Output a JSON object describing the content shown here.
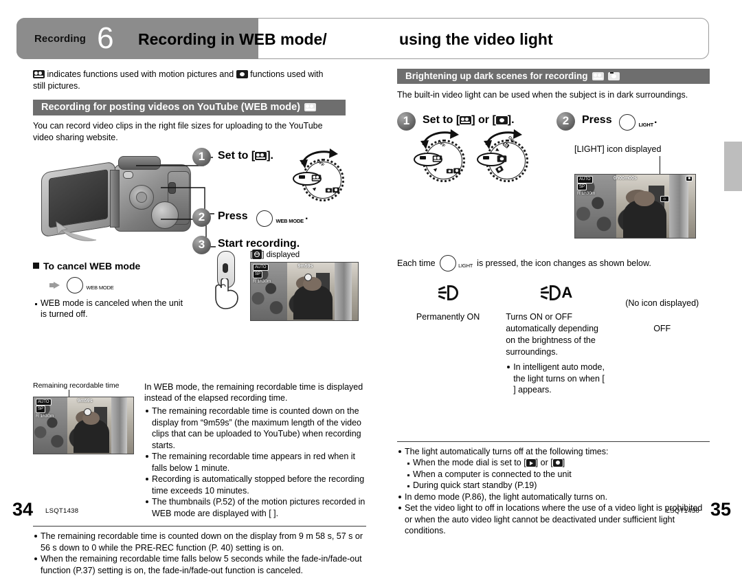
{
  "header": {
    "chapter_label": "Recording",
    "chapter_number": "6",
    "title_left": "Recording in WEB mode/",
    "title_right": "using the video light"
  },
  "left_page": {
    "intro": {
      "text_before": "indicates functions used with motion pictures and",
      "text_middle": "functions used with",
      "text_after": "still pictures.",
      "icon_motion": "motion-picture-icon",
      "icon_still": "still-picture-icon"
    },
    "section_band": {
      "label": "Recording for posting videos on YouTube (WEB mode)",
      "icon": "motion-picture-icon"
    },
    "section_desc": "You can record video clips in the right file sizes for uploading to the YouTube video sharing website.",
    "steps": [
      {
        "number": "1",
        "label": "Set to [",
        "label_end": "]."
      },
      {
        "number": "2",
        "label": "Press",
        "button_caption": "WEB MODE"
      },
      {
        "number": "3",
        "label": "Start recording."
      }
    ],
    "step3_caption": "] displayed",
    "cancel_heading": "To cancel WEB mode",
    "cancel_button_caption": "WEB MODE",
    "cancel_note": "WEB mode is canceled when the unit is turned off.",
    "thumb_caption": "Remaining recordable time",
    "thumb_osd": {
      "auto_chip": "AUTO",
      "timer": "9m59s",
      "card_chip": "SP",
      "remain": "R 1h30m"
    },
    "explain_intro": "In WEB mode, the remaining recordable time is displayed instead of the elapsed recording time.",
    "bullets": [
      "The remaining recordable time is counted down on the display from “9m59s” (the maximum length of the video clips that can be uploaded to YouTube) when recording starts.",
      "The remaining recordable time appears in red when it falls below 1 minute.",
      "Recording is automatically stopped before the recording time exceeds 10 minutes.",
      "The thumbnails (P.52) of the motion pictures recorded in WEB mode are displayed with [      ]."
    ],
    "footer_bullets": [
      "The remaining recordable time is counted down on the display from 9 m 58 s, 57 s or 56 s down to 0 while the PRE-REC function (P. 40) setting is on.",
      "When the remaining recordable time falls below 5 seconds while the fade-in/fade-out function (P.37) setting is on, the fade-in/fade-out function is canceled."
    ],
    "page_number": "34",
    "doc_code": "LSQT1438"
  },
  "right_page": {
    "section_band": {
      "label": "Brightening up dark scenes for recording",
      "icon_motion": "motion-picture-icon",
      "icon_still": "still-picture-icon"
    },
    "section_desc": "The built-in video light can be used when the subject is in dark surroundings.",
    "step1": {
      "number": "1",
      "label_start": "Set to [",
      "label_mid": "] or [",
      "label_end": "]."
    },
    "step2": {
      "number": "2",
      "label": "Press",
      "button_caption": "LIGHT"
    },
    "lcd_caption": "[LIGHT] icon displayed",
    "lcd_osd": {
      "auto_chip": "AUTO",
      "timer": "0h00m00s",
      "card_chip": "SP",
      "remain": "R 1h30m",
      "light_badge": "LIGHT"
    },
    "each_time": {
      "before": "Each time",
      "after": "is pressed, the icon changes as shown below.",
      "button_caption": "LIGHT"
    },
    "modes": [
      {
        "icon": "video-light-on-icon",
        "title": "Permanently ON",
        "body": "",
        "note": ""
      },
      {
        "icon": "video-light-auto-icon",
        "title": "Turns ON or OFF automatically depending on the brightness of the surroundings.",
        "note": "In intelligent auto mode, the light turns on when [      ] appears."
      },
      {
        "icon": "no-icon",
        "icon_text": "(No icon displayed)",
        "title": "OFF"
      }
    ],
    "notes": [
      "The light automatically turns off at the following times:",
      "When the mode dial is set to [",
      "When a computer is connected to the unit",
      "During quick start standby (P.19)",
      "In demo mode (P.86), the light automatically turns on.",
      "Set the video light to off in locations where the use of a video light is prohibited or when the auto video light cannot be deactivated under sufficient light conditions."
    ],
    "notes_sub_suffix": "] or [",
    "page_number": "35",
    "doc_code": "LSQT1438"
  },
  "colors": {
    "band_gray": "#6e6e6e",
    "header_tab_gray": "#8c8c8c",
    "edge_tab_gray": "#bdbdbd",
    "text_black": "#000000"
  }
}
